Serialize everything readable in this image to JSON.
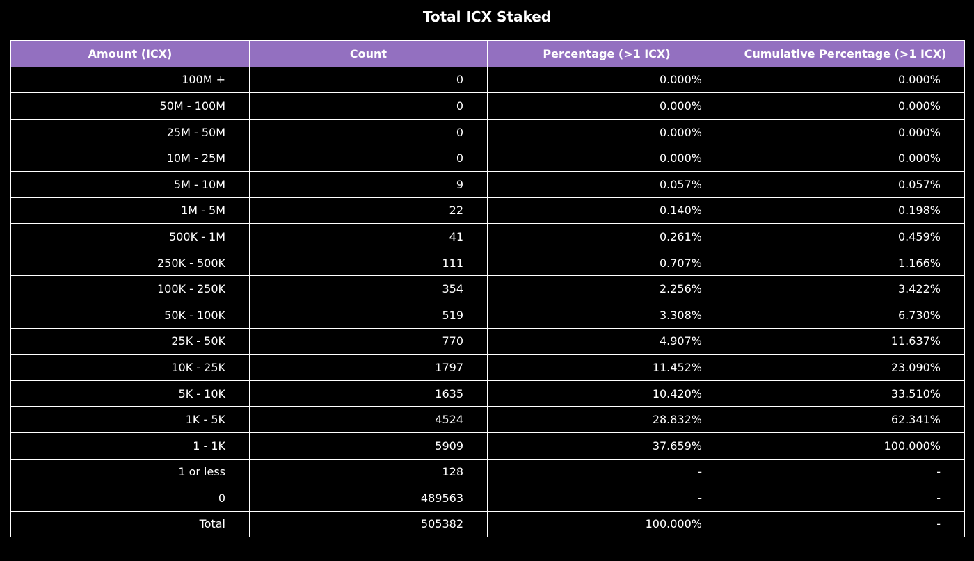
{
  "chart_data": {
    "type": "table",
    "title": "Total ICX Staked",
    "columns": [
      "Amount (ICX)",
      "Count",
      "Percentage (>1 ICX)",
      "Cumulative Percentage (>1 ICX)"
    ],
    "rows": [
      [
        "100M +",
        "0",
        "0.000%",
        "0.000%"
      ],
      [
        "50M - 100M",
        "0",
        "0.000%",
        "0.000%"
      ],
      [
        "25M - 50M",
        "0",
        "0.000%",
        "0.000%"
      ],
      [
        "10M - 25M",
        "0",
        "0.000%",
        "0.000%"
      ],
      [
        "5M - 10M",
        "9",
        "0.057%",
        "0.057%"
      ],
      [
        "1M - 5M",
        "22",
        "0.140%",
        "0.198%"
      ],
      [
        "500K - 1M",
        "41",
        "0.261%",
        "0.459%"
      ],
      [
        "250K - 500K",
        "111",
        "0.707%",
        "1.166%"
      ],
      [
        "100K - 250K",
        "354",
        "2.256%",
        "3.422%"
      ],
      [
        "50K - 100K",
        "519",
        "3.308%",
        "6.730%"
      ],
      [
        "25K - 50K",
        "770",
        "4.907%",
        "11.637%"
      ],
      [
        "10K - 25K",
        "1797",
        "11.452%",
        "23.090%"
      ],
      [
        "5K - 10K",
        "1635",
        "10.420%",
        "33.510%"
      ],
      [
        "1K - 5K",
        "4524",
        "28.832%",
        "62.341%"
      ],
      [
        "1 - 1K",
        "5909",
        "37.659%",
        "100.000%"
      ],
      [
        "1 or less",
        "128",
        "-",
        "-"
      ],
      [
        "0",
        "489563",
        "-",
        "-"
      ],
      [
        "Total",
        "505382",
        "100.000%",
        "-"
      ]
    ],
    "header_color": "#9370c0",
    "background_color": "#000000"
  }
}
